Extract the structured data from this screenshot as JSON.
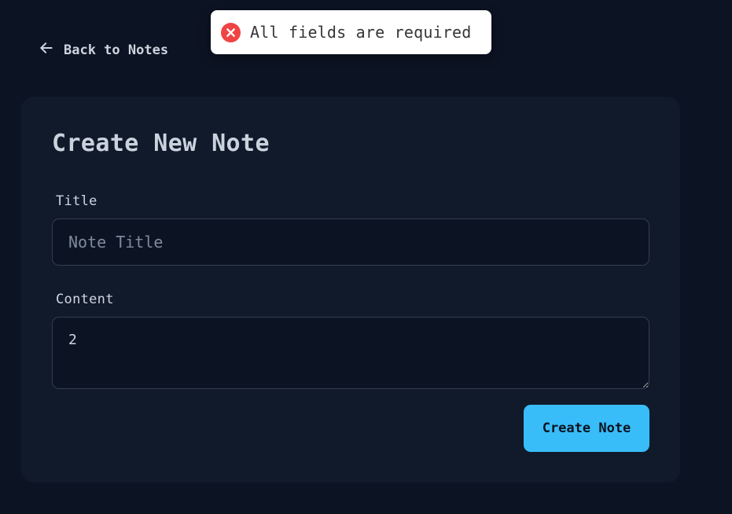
{
  "toast": {
    "icon": "error-circle-icon",
    "message": "All fields are required",
    "accent": "#ef4444"
  },
  "nav": {
    "back_icon": "arrow-left-icon",
    "back_label": "Back to Notes"
  },
  "form": {
    "heading": "Create New Note",
    "title_label": "Title",
    "title_value": "",
    "title_placeholder": "Note Title",
    "content_label": "Content",
    "content_value": "2",
    "submit_label": "Create Note"
  },
  "colors": {
    "background": "#0c1322",
    "card": "#101a2a",
    "button": "#38bdf8"
  }
}
